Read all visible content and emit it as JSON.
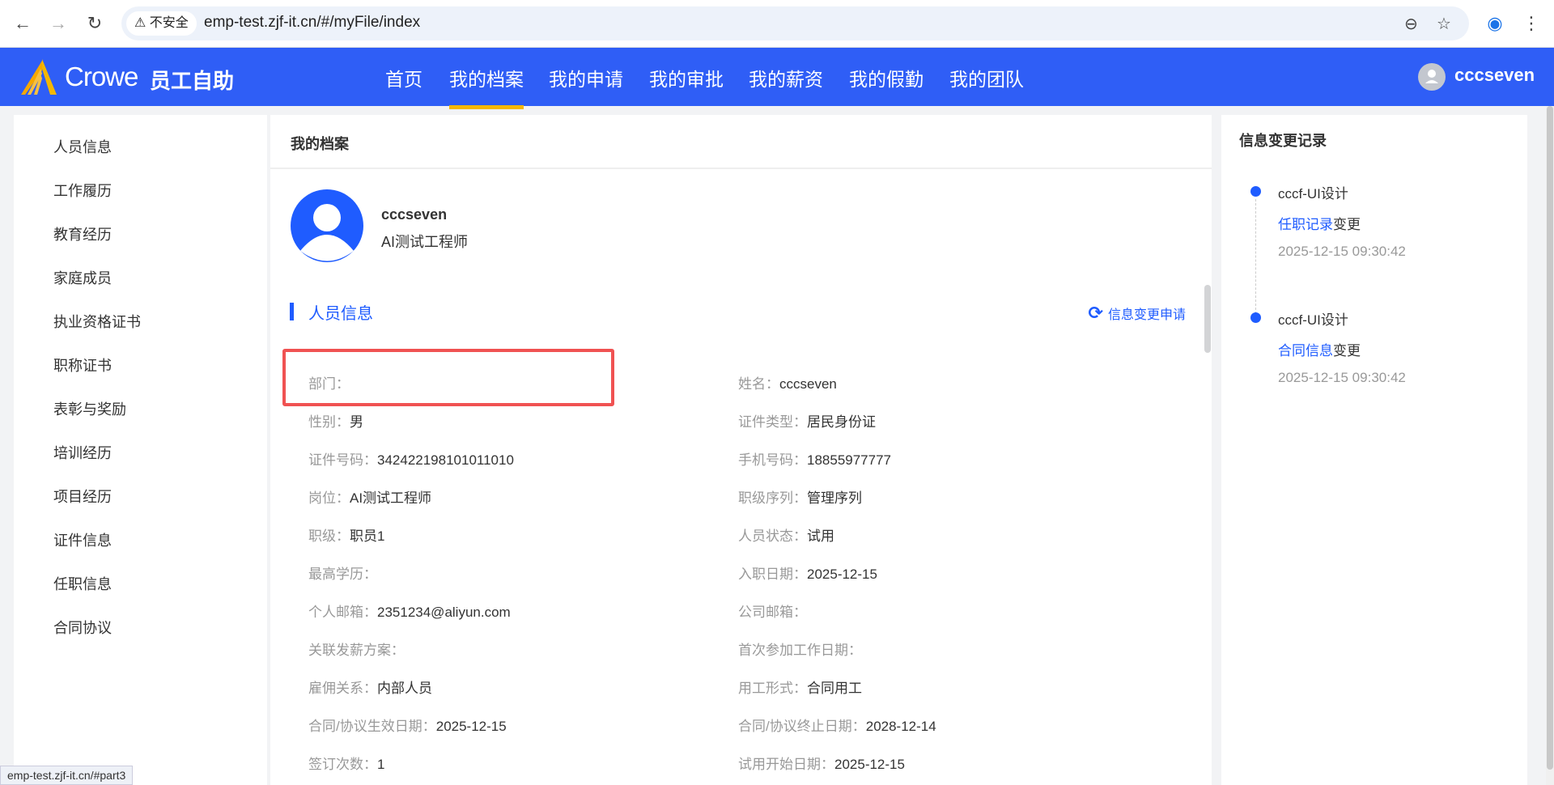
{
  "browser": {
    "security": "不安全",
    "url": "emp-test.zjf-it.cn/#/myFile/index",
    "status_url": "emp-test.zjf-it.cn/#part3"
  },
  "header": {
    "brand": "Crowe",
    "app_name": "员工自助",
    "user": "cccseven",
    "nav": [
      "首页",
      "我的档案",
      "我的申请",
      "我的审批",
      "我的薪资",
      "我的假勤",
      "我的团队"
    ],
    "active_nav": "我的档案"
  },
  "sidebar": {
    "items": [
      "人员信息",
      "工作履历",
      "教育经历",
      "家庭成员",
      "执业资格证书",
      "职称证书",
      "表彰与奖励",
      "培训经历",
      "项目经历",
      "证件信息",
      "任职信息",
      "合同协议"
    ]
  },
  "main": {
    "title": "我的档案",
    "profile": {
      "name": "cccseven",
      "position": "AI测试工程师"
    },
    "section_title": "人员信息",
    "change_request": "信息变更申请",
    "fields_left": [
      {
        "label": "部门：",
        "value": ""
      },
      {
        "label": "性别：",
        "value": "男"
      },
      {
        "label": "证件号码：",
        "value": "342422198101011010"
      },
      {
        "label": "岗位：",
        "value": "AI测试工程师"
      },
      {
        "label": "职级：",
        "value": "职员1"
      },
      {
        "label": "最高学历：",
        "value": ""
      },
      {
        "label": "个人邮箱：",
        "value": "2351234@aliyun.com"
      },
      {
        "label": "关联发薪方案：",
        "value": ""
      },
      {
        "label": "雇佣关系：",
        "value": "内部人员"
      },
      {
        "label": "合同/协议生效日期：",
        "value": "2025-12-15"
      },
      {
        "label": "签订次数：",
        "value": "1"
      }
    ],
    "fields_right": [
      {
        "label": "姓名：",
        "value": "cccseven"
      },
      {
        "label": "证件类型：",
        "value": "居民身份证"
      },
      {
        "label": "手机号码：",
        "value": "18855977777"
      },
      {
        "label": "职级序列：",
        "value": "管理序列"
      },
      {
        "label": "人员状态：",
        "value": "试用"
      },
      {
        "label": "入职日期：",
        "value": "2025-12-15"
      },
      {
        "label": "公司邮箱：",
        "value": ""
      },
      {
        "label": "首次参加工作日期：",
        "value": ""
      },
      {
        "label": "用工形式：",
        "value": "合同用工"
      },
      {
        "label": "合同/协议终止日期：",
        "value": "2028-12-14"
      },
      {
        "label": "试用开始日期：",
        "value": "2025-12-15"
      }
    ]
  },
  "changes": {
    "title": "信息变更记录",
    "records": [
      {
        "user": "cccf-UI设计",
        "link": "任职记录",
        "suffix": "变更",
        "time": "2025-12-15 09:30:42"
      },
      {
        "user": "cccf-UI设计",
        "link": "合同信息",
        "suffix": "变更",
        "time": "2025-12-15 09:30:42"
      }
    ]
  },
  "colors": {
    "header": "#2f5ef6",
    "accent": "#1f5cff",
    "highlight": "#f05252",
    "nav_underline": "#f5b700"
  }
}
